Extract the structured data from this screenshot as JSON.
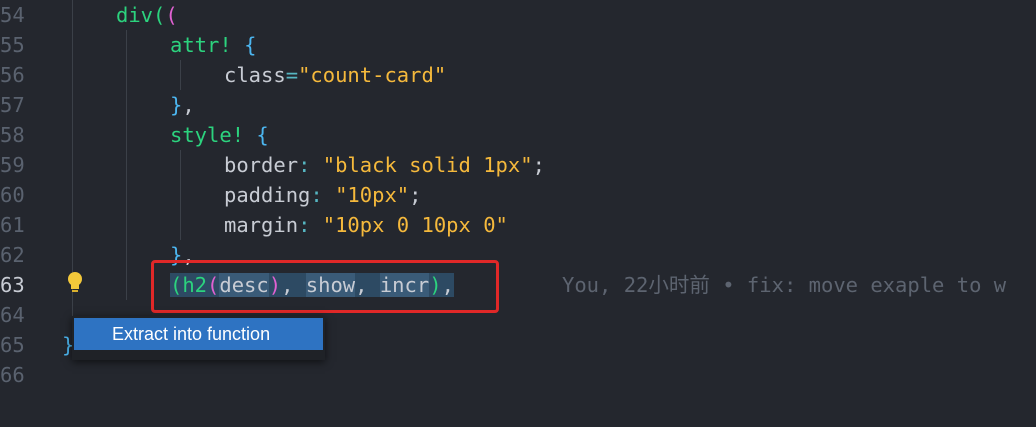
{
  "editor": {
    "lines": [
      {
        "num": "54",
        "tokens": [
          [
            "fn",
            "div"
          ],
          [
            "p1",
            "("
          ],
          [
            "p2",
            "("
          ]
        ]
      },
      {
        "num": "55",
        "tokens": [
          [
            "mac",
            "attr!"
          ],
          [
            "punc",
            " "
          ],
          [
            "p3",
            "{"
          ]
        ]
      },
      {
        "num": "56",
        "tokens": [
          [
            "prop",
            "class"
          ],
          [
            "op",
            "="
          ],
          [
            "str",
            "\"count-card\""
          ]
        ]
      },
      {
        "num": "57",
        "tokens": [
          [
            "p3",
            "}"
          ],
          [
            "punc",
            ","
          ]
        ]
      },
      {
        "num": "58",
        "tokens": [
          [
            "mac",
            "style!"
          ],
          [
            "punc",
            " "
          ],
          [
            "p3",
            "{"
          ]
        ]
      },
      {
        "num": "59",
        "tokens": [
          [
            "prop",
            "border"
          ],
          [
            "op",
            ":"
          ],
          [
            "punc",
            " "
          ],
          [
            "str",
            "\"black solid 1px\""
          ],
          [
            "punc",
            ";"
          ]
        ]
      },
      {
        "num": "60",
        "tokens": [
          [
            "prop",
            "padding"
          ],
          [
            "op",
            ":"
          ],
          [
            "punc",
            " "
          ],
          [
            "str",
            "\"10px\""
          ],
          [
            "punc",
            ";"
          ]
        ]
      },
      {
        "num": "61",
        "tokens": [
          [
            "prop",
            "margin"
          ],
          [
            "op",
            ":"
          ],
          [
            "punc",
            " "
          ],
          [
            "str",
            "\"10px 0 10px 0\""
          ]
        ]
      },
      {
        "num": "62",
        "tokens": [
          [
            "p3",
            "}"
          ],
          [
            "punc",
            ","
          ]
        ]
      },
      {
        "num": "63",
        "tokens": [
          [
            "p1 sel",
            "("
          ],
          [
            "fn sel",
            "h2"
          ],
          [
            "p2 sel",
            "("
          ],
          [
            "var sel2",
            "desc"
          ],
          [
            "p2 sel",
            ")"
          ],
          [
            "punc sel",
            ", "
          ],
          [
            "var sel2",
            "show"
          ],
          [
            "punc sel",
            ", "
          ],
          [
            "var sel2",
            "incr"
          ],
          [
            "p1 sel",
            ")"
          ],
          [
            "punc sel",
            ","
          ]
        ]
      },
      {
        "num": "64",
        "tokens": []
      },
      {
        "num": "65",
        "tokens": [
          [
            "p3",
            "}"
          ]
        ]
      },
      {
        "num": "66",
        "tokens": []
      }
    ],
    "active_line": "63",
    "blame": "You, 22小时前 • fix: move exaple to w"
  },
  "context_menu": {
    "items": [
      {
        "label": "Extract into function"
      }
    ]
  },
  "colors": {
    "background": "#24272e",
    "selection": "#2d4a63",
    "highlight_border": "#e02828",
    "menu_selected": "#2e73c2"
  }
}
